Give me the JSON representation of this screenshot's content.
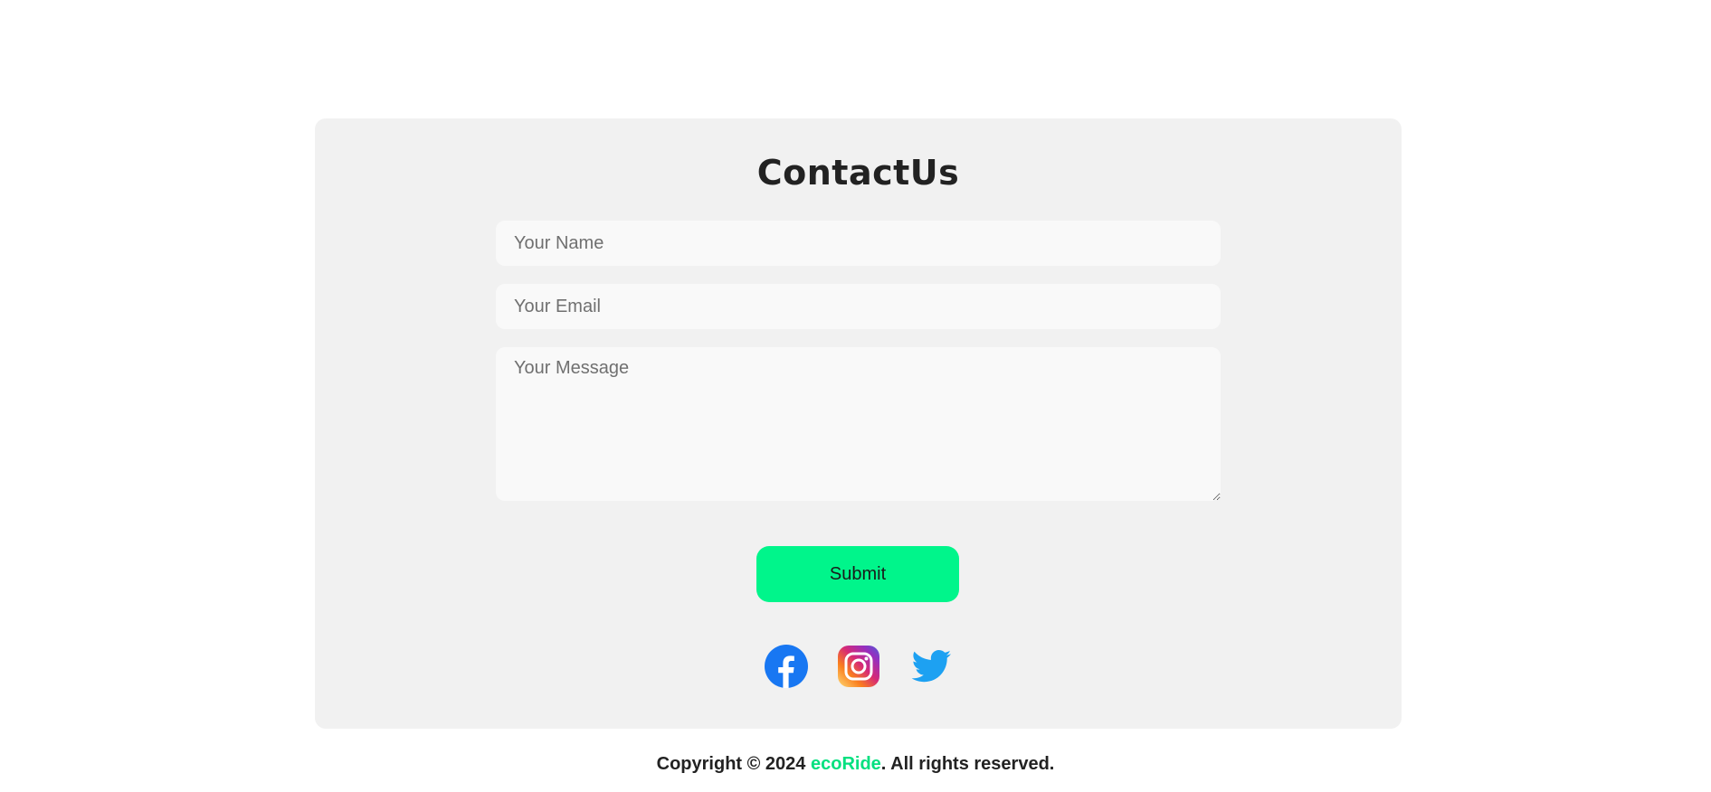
{
  "contact": {
    "title": "ContactUs",
    "name_placeholder": "Your Name",
    "email_placeholder": "Your Email",
    "message_placeholder": "Your Message",
    "submit_label": "Submit"
  },
  "social": {
    "icons": [
      "facebook-icon",
      "instagram-icon",
      "twitter-icon"
    ]
  },
  "footer": {
    "prefix": "Copyright © 2024 ",
    "brand": "ecoRide",
    "suffix": ". All rights reserved."
  },
  "colors": {
    "accent": "#00f58b",
    "brand_text": "#00e07f",
    "card_bg": "#f1f1f1",
    "facebook": "#1877f2",
    "twitter": "#1da1f2"
  }
}
